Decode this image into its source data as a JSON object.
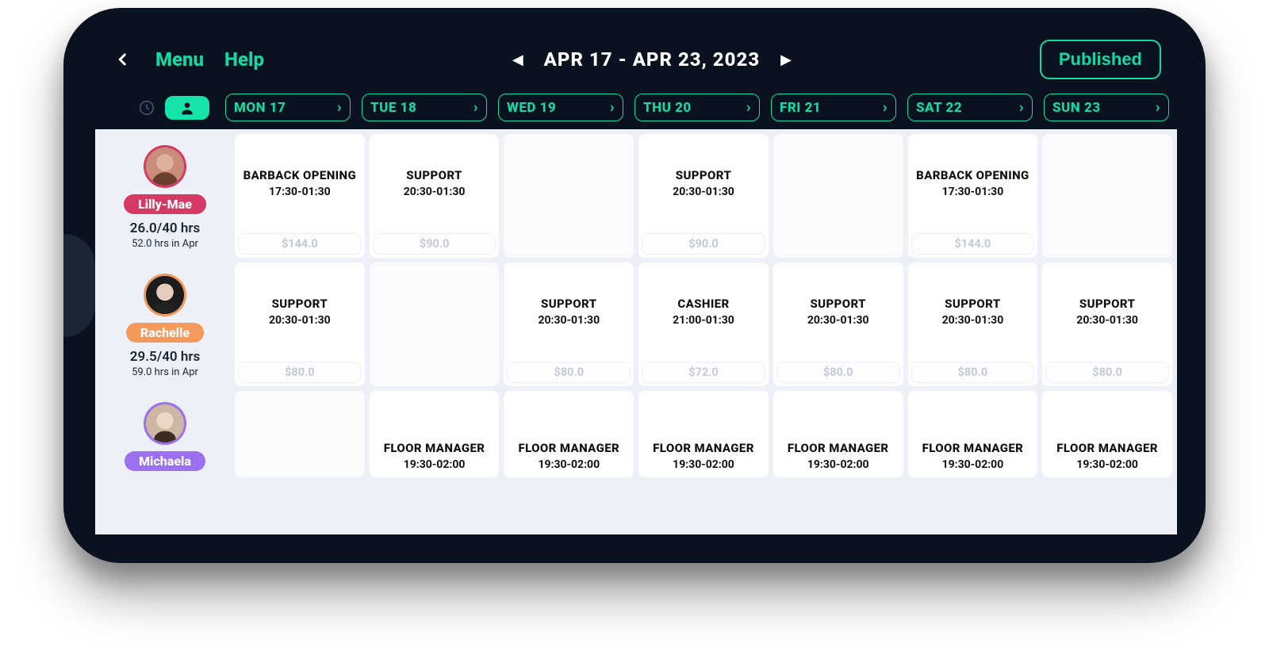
{
  "header": {
    "menu_label": "Menu",
    "help_label": "Help",
    "date_range": "APR 17 - APR 23, 2023",
    "published_label": "Published"
  },
  "days": [
    {
      "label": "MON 17"
    },
    {
      "label": "TUE 18"
    },
    {
      "label": "WED 19"
    },
    {
      "label": "THU 20"
    },
    {
      "label": "FRI 21"
    },
    {
      "label": "SAT 22"
    },
    {
      "label": "SUN 23"
    }
  ],
  "employees": [
    {
      "name": "Lilly-Mae",
      "color": "#d43a63",
      "hours": "26.0/40 hrs",
      "month_hours": "52.0 hrs in Apr",
      "shifts": [
        {
          "role": "BARBACK OPENING",
          "time": "17:30-01:30",
          "cost": "$144.0"
        },
        {
          "role": "SUPPORT",
          "time": "20:30-01:30",
          "cost": "$90.0"
        },
        null,
        {
          "role": "SUPPORT",
          "time": "20:30-01:30",
          "cost": "$90.0"
        },
        null,
        {
          "role": "BARBACK OPENING",
          "time": "17:30-01:30",
          "cost": "$144.0"
        },
        null
      ]
    },
    {
      "name": "Rachelle",
      "color": "#f3995b",
      "hours": "29.5/40 hrs",
      "month_hours": "59.0 hrs in Apr",
      "shifts": [
        {
          "role": "SUPPORT",
          "time": "20:30-01:30",
          "cost": "$80.0"
        },
        null,
        {
          "role": "SUPPORT",
          "time": "20:30-01:30",
          "cost": "$80.0"
        },
        {
          "role": "CASHIER",
          "time": "21:00-01:30",
          "cost": "$72.0"
        },
        {
          "role": "SUPPORT",
          "time": "20:30-01:30",
          "cost": "$80.0"
        },
        {
          "role": "SUPPORT",
          "time": "20:30-01:30",
          "cost": "$80.0"
        },
        {
          "role": "SUPPORT",
          "time": "20:30-01:30",
          "cost": "$80.0"
        }
      ]
    },
    {
      "name": "Michaela",
      "color": "#9b70f1",
      "hours": "",
      "month_hours": "",
      "shifts": [
        null,
        {
          "role": "FLOOR MANAGER",
          "time": "19:30-02:00"
        },
        {
          "role": "FLOOR MANAGER",
          "time": "19:30-02:00"
        },
        {
          "role": "FLOOR MANAGER",
          "time": "19:30-02:00"
        },
        {
          "role": "FLOOR MANAGER",
          "time": "19:30-02:00"
        },
        {
          "role": "FLOOR MANAGER",
          "time": "19:30-02:00"
        },
        {
          "role": "FLOOR MANAGER",
          "time": "19:30-02:00"
        }
      ]
    }
  ]
}
